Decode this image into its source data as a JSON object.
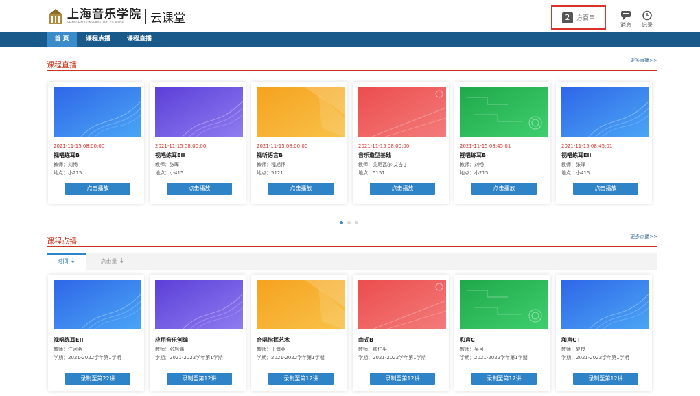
{
  "header": {
    "logo_cn": "上海音乐学院",
    "logo_en": "SHANGHAI CONSERVATORY OF MUSIC",
    "logo_sub": "云课堂",
    "user": {
      "avatar_char": "2",
      "name": "方百申"
    },
    "messages_label": "消息",
    "records_label": "记录"
  },
  "nav": {
    "items": [
      "首 页",
      "课程点播",
      "课程直播"
    ]
  },
  "live": {
    "title": "课程直播",
    "more": "更多直播>>",
    "cards": [
      {
        "time": "2021-11-15 08:00:00",
        "title": "视唱练耳B",
        "teacher": "教师：刘畅",
        "place": "地点：小215",
        "button": "点击播放",
        "theme": "blue"
      },
      {
        "time": "2021-11-15 08:00:00",
        "title": "视唱练耳EII",
        "teacher": "教师：张晖",
        "place": "地点：小415",
        "button": "点击播放",
        "theme": "purple"
      },
      {
        "time": "2021-11-15 08:00:00",
        "title": "视听语言B",
        "teacher": "教师：程旭怀",
        "place": "地点：5121",
        "button": "点击播放",
        "theme": "orange"
      },
      {
        "time": "2021-11-15 08:00:00",
        "title": "音乐造型基础",
        "teacher": "教师：艾尼瓦尔·艾吉丁",
        "place": "地点：5151",
        "button": "点击播放",
        "theme": "red"
      },
      {
        "time": "2021-11-15 08:45:01",
        "title": "视唱练耳B",
        "teacher": "教师：刘畅",
        "place": "地点：小215",
        "button": "点击播放",
        "theme": "green"
      },
      {
        "time": "2021-11-15 08:45:01",
        "title": "视唱练耳EII",
        "teacher": "教师：张晖",
        "place": "地点：小415",
        "button": "点击播放",
        "theme": "blue"
      }
    ]
  },
  "vod": {
    "title": "课程点播",
    "more": "更多点播>>",
    "sort_time": "时间",
    "sort_clicks": "点击量",
    "cards": [
      {
        "title": "视唱练耳EII",
        "teacher": "教师：江河茗",
        "term": "学期：2021-2022学年第1学期",
        "button": "录制至第22讲",
        "theme": "blue"
      },
      {
        "title": "应用音乐创编",
        "teacher": "教师：张旭偶",
        "term": "学期：2021-2022学年第1学期",
        "button": "录制至第12讲",
        "theme": "purple"
      },
      {
        "title": "合唱指挥艺术",
        "teacher": "教师：王海英",
        "term": "学期：2021-2022学年第1学期",
        "button": "录制至第12讲",
        "theme": "orange"
      },
      {
        "title": "曲式B",
        "teacher": "教师：钱仁平",
        "term": "学期：2021-2022学年第1学期",
        "button": "录制至第12讲",
        "theme": "red"
      },
      {
        "title": "和声C",
        "teacher": "教师：吴可",
        "term": "学期：2021-2022学年第1学期",
        "button": "录制至第12讲",
        "theme": "green"
      },
      {
        "title": "和声C+",
        "teacher": "教师：夏良",
        "term": "学期：2021-2022学年第1学期",
        "button": "录制至第12讲",
        "theme": "blue"
      }
    ]
  },
  "theme_colors": {
    "blue": [
      "#2f66e8",
      "#4aa6f5"
    ],
    "purple": [
      "#5b3fd8",
      "#8f7cf0"
    ],
    "orange": [
      "#f6a21e",
      "#f8c24a"
    ],
    "red": [
      "#ec4d4d",
      "#f37b7b"
    ],
    "green": [
      "#1fa84a",
      "#3fcf6e"
    ]
  }
}
